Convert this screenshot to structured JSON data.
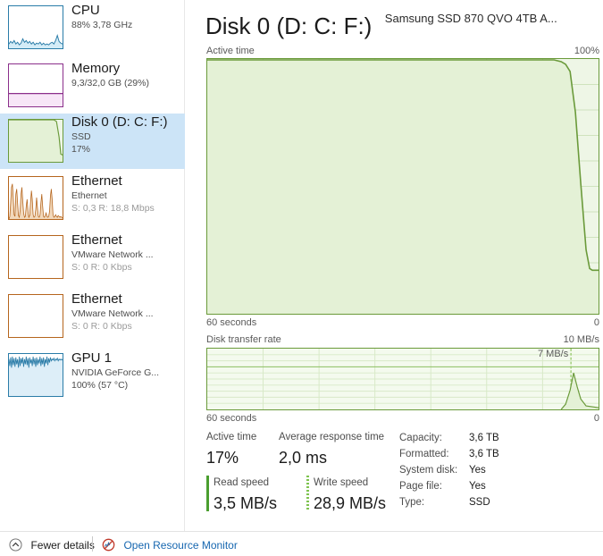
{
  "sidebar": {
    "items": [
      {
        "name": "cpu",
        "title": "CPU",
        "sub": "88%  3,78 GHz",
        "sub2": "",
        "selected": false,
        "color": "#2a7ca8",
        "graph_kind": "line-low"
      },
      {
        "name": "memory",
        "title": "Memory",
        "sub": "9,3/32,0 GB (29%)",
        "sub2": "",
        "selected": false,
        "color": "#8b2f8b",
        "graph_kind": "fill-29"
      },
      {
        "name": "disk-0",
        "title": "Disk 0 (D: C: F:)",
        "sub": "SSD",
        "sub2": "17%",
        "selected": true,
        "color": "#6a9a3a",
        "graph_kind": "disk"
      },
      {
        "name": "ethernet-1",
        "title": "Ethernet",
        "sub": "Ethernet",
        "sub2": "S: 0,3 R: 18,8 Mbps",
        "selected": false,
        "color": "#b5651d",
        "graph_kind": "spiky"
      },
      {
        "name": "ethernet-2",
        "title": "Ethernet",
        "sub": "VMware Network ...",
        "sub2": "S: 0 R: 0 Kbps",
        "selected": false,
        "color": "#b5651d",
        "graph_kind": "empty"
      },
      {
        "name": "ethernet-3",
        "title": "Ethernet",
        "sub": "VMware Network ...",
        "sub2": "S: 0 R: 0 Kbps",
        "selected": false,
        "color": "#b5651d",
        "graph_kind": "empty"
      },
      {
        "name": "gpu-1",
        "title": "GPU 1",
        "sub": "NVIDIA GeForce G...",
        "sub2": "100%  (57 °C)",
        "selected": false,
        "color": "#2a7ca8",
        "graph_kind": "gpu"
      }
    ]
  },
  "header": {
    "title": "Disk 0 (D: C: F:)",
    "subtitle": "Samsung SSD 870 QVO 4TB A..."
  },
  "graphs": {
    "active_time": {
      "label": "Active time",
      "max_label": "100%",
      "time_left": "60 seconds",
      "time_right": "0"
    },
    "transfer_rate": {
      "label": "Disk transfer rate",
      "max_label": "10 MB/s",
      "annotation": "7 MB/s",
      "time_left": "60 seconds",
      "time_right": "0"
    }
  },
  "stats": {
    "active_time_label": "Active time",
    "active_time_value": "17%",
    "avg_response_label": "Average response time",
    "avg_response_value": "2,0 ms",
    "read_speed_label": "Read speed",
    "read_speed_value": "3,5 MB/s",
    "write_speed_label": "Write speed",
    "write_speed_value": "28,9 MB/s",
    "info": [
      {
        "label": "Capacity:",
        "value": "3,6 TB"
      },
      {
        "label": "Formatted:",
        "value": "3,6 TB"
      },
      {
        "label": "System disk:",
        "value": "Yes"
      },
      {
        "label": "Page file:",
        "value": "Yes"
      },
      {
        "label": "Type:",
        "value": "SSD"
      }
    ]
  },
  "bottom_bar": {
    "fewer_details": "Fewer details",
    "open_resource_monitor": "Open Resource Monitor"
  },
  "colors": {
    "accent_green": "#6a9a3a",
    "graph_fill": "#eef6e6",
    "selection": "#cce4f7",
    "link": "#1767b0"
  },
  "chart_data": [
    {
      "type": "area",
      "title": "Active time",
      "ylabel": "%",
      "ylim": [
        0,
        100
      ],
      "xlabel": "60 seconds",
      "x": [
        0,
        5,
        10,
        15,
        20,
        25,
        30,
        35,
        40,
        45,
        50,
        52,
        54,
        55,
        56,
        57,
        58,
        59,
        60
      ],
      "values": [
        100,
        100,
        100,
        100,
        100,
        100,
        100,
        100,
        100,
        100,
        100,
        100,
        99,
        98,
        92,
        74,
        50,
        30,
        17
      ],
      "grid": true,
      "legend": "none"
    },
    {
      "type": "area",
      "title": "Disk transfer rate",
      "ylabel": "MB/s",
      "ylim": [
        0,
        10
      ],
      "xlabel": "60 seconds",
      "annotation": "7 MB/s",
      "x": [
        0,
        10,
        20,
        30,
        40,
        50,
        54,
        55,
        56,
        57,
        58,
        59,
        60
      ],
      "values": [
        0,
        0,
        0,
        0,
        0,
        0,
        0,
        0.2,
        1.0,
        2.6,
        4.0,
        2.2,
        0.3
      ],
      "grid": true,
      "legend": "none"
    }
  ]
}
